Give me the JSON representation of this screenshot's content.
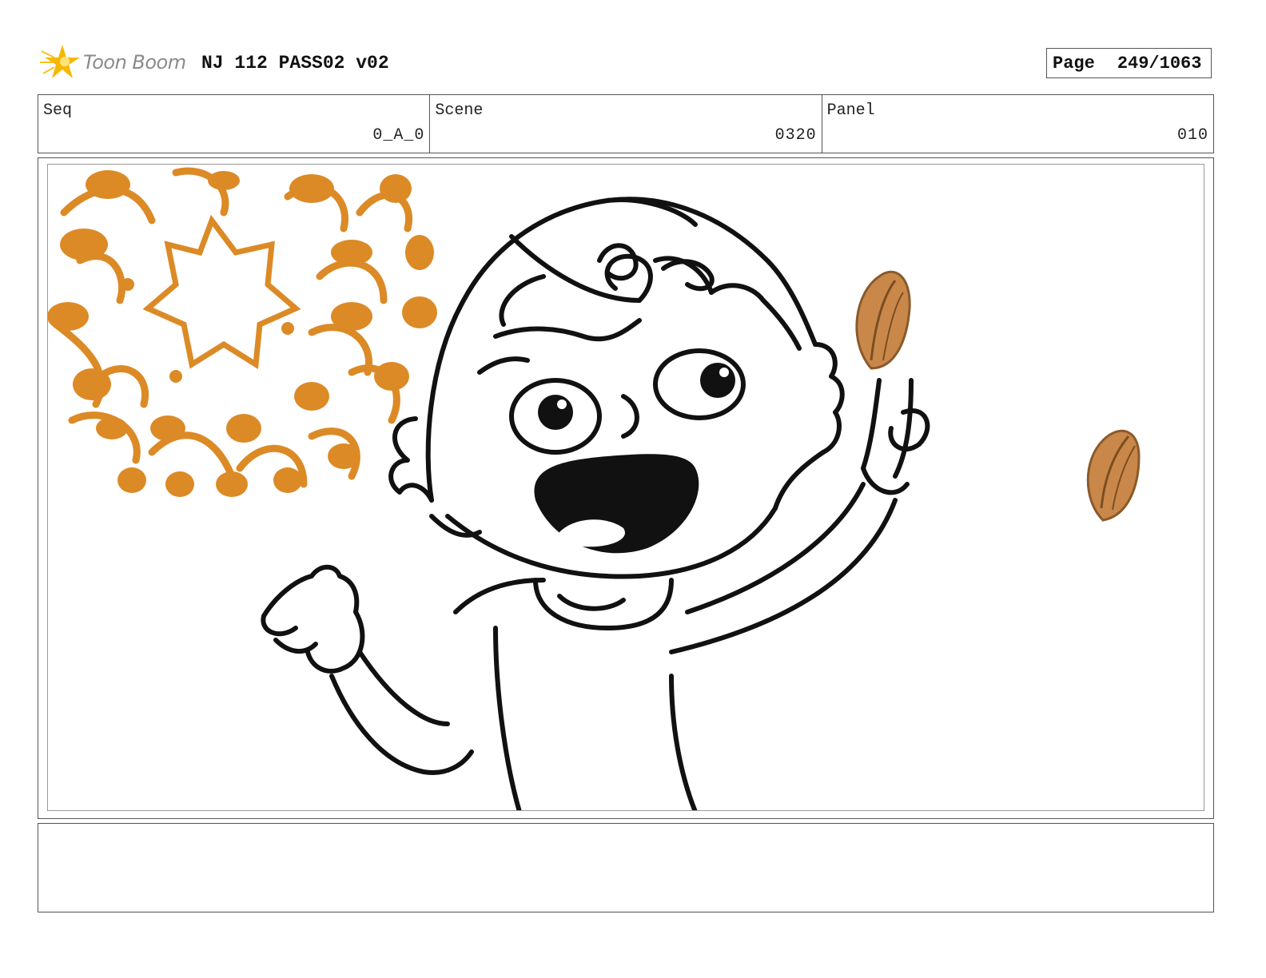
{
  "header": {
    "logo_text": "Toon Boom",
    "title": "NJ 112 PASS02 v02",
    "page_label": "Page",
    "page_value": "249/1063"
  },
  "info": {
    "seq_label": "Seq",
    "seq_value": "0_A_0",
    "scene_label": "Scene",
    "scene_value": "0320",
    "panel_label": "Panel",
    "panel_value": "010"
  },
  "notes": {
    "text": ""
  },
  "colors": {
    "accent_orange": "#dc8a26",
    "almond": "#c9884a",
    "ink": "#111111",
    "logo_star": "#f5b800"
  },
  "icons": {
    "logo": "toon-boom-star-logo"
  }
}
